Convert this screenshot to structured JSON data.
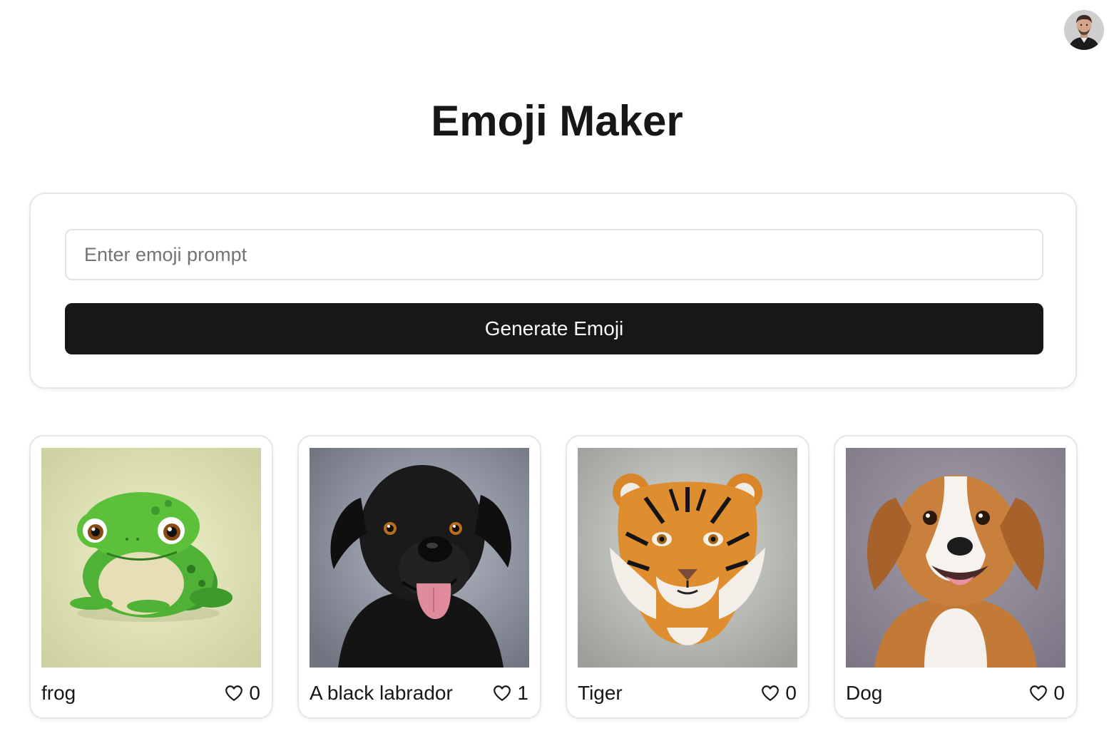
{
  "header": {
    "user_avatar": "user-portrait-avatar"
  },
  "title": "Emoji Maker",
  "form": {
    "prompt_placeholder": "Enter emoji prompt",
    "prompt_value": "",
    "generate_label": "Generate Emoji"
  },
  "emojis": [
    {
      "label": "frog",
      "likes": "0",
      "image": "frog-emoji-image"
    },
    {
      "label": "A black labrador",
      "likes": "1",
      "image": "black-labrador-emoji-image"
    },
    {
      "label": "Tiger",
      "likes": "0",
      "image": "tiger-emoji-image"
    },
    {
      "label": "Dog",
      "likes": "0",
      "image": "dog-emoji-image"
    }
  ],
  "icons": {
    "like": "heart-icon"
  },
  "colors": {
    "primary_button": "#171717",
    "card_border": "#e6e6e6",
    "text": "#171717",
    "placeholder": "#737373"
  }
}
